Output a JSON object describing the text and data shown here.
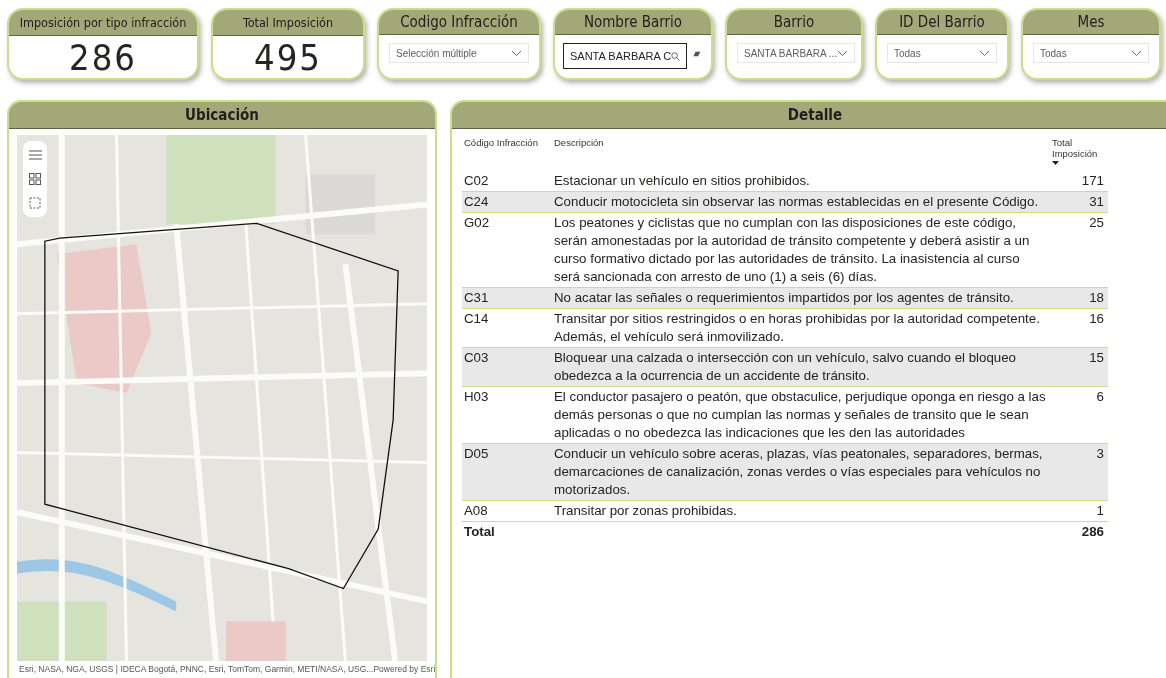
{
  "cards": [
    {
      "kind": "kpi",
      "title": "Imposición por tipo infracción",
      "value": "286"
    },
    {
      "kind": "kpi",
      "title": "Total Imposición",
      "value": "495"
    },
    {
      "kind": "dropdown",
      "title": "Codigo Infracción",
      "value": "Selección múltiple"
    },
    {
      "kind": "search",
      "title": "Nombre Barrio",
      "value": "SANTA BARBARA C"
    },
    {
      "kind": "dropdown",
      "title": "Barrio",
      "value": "SANTA BARBARA ..."
    },
    {
      "kind": "dropdown",
      "title": "ID Del Barrio",
      "value": "Todas"
    },
    {
      "kind": "dropdown",
      "title": "Mes",
      "value": "Todas"
    }
  ],
  "map": {
    "title": "Ubicación",
    "attribution": "Esri, NASA, NGA, USGS | IDECA Bogotá, PNNC, Esri, TomTom, Garmin, METI/NASA, USG...",
    "powered_by": "Powered by",
    "powered_link": "Esri"
  },
  "detail": {
    "title": "Detalle",
    "columns": [
      {
        "label": "Código Infracción",
        "sorted": false
      },
      {
        "label": "Descripción",
        "sorted": false
      },
      {
        "label": "Total Imposición",
        "sorted": true
      }
    ],
    "rows": [
      {
        "code": "C02",
        "description": "Estacionar un vehículo en sitios prohibidos.",
        "total": "171"
      },
      {
        "code": "C24",
        "description": "Conducir motocicleta sin observar las normas establecidas en el presente Código.",
        "total": "31"
      },
      {
        "code": "G02",
        "description": "Los peatones y ciclistas que no cumplan con las disposiciones de este código, serán amonestadas por la autoridad de tránsito competente y deberá asistir a un curso formativo dictado por las autoridades de tránsito. La inasistencia al curso será sancionada con arresto de uno (1) a seis (6) días.",
        "total": "25"
      },
      {
        "code": "C31",
        "description": "No acatar las señales o requerimientos impartidos por los agentes de tránsito.",
        "total": "18"
      },
      {
        "code": "C14",
        "description": "Transitar por sitios restringidos o en horas prohibidas por la autoridad competente. Además, el vehículo será inmovilizado.",
        "total": "16"
      },
      {
        "code": "C03",
        "description": "Bloquear una calzada o intersección con un vehículo, salvo cuando el bloqueo obedezca a la ocurrencia de un accidente de tránsito.",
        "total": "15"
      },
      {
        "code": "H03",
        "description": "El conductor pasajero o peatón, que obstaculice, perjudique oponga en riesgo a las demás personas o que no cumplan las normas y señales de transito que le sean aplicadas o no obedezca las indicaciones que les den las autoridades",
        "total": "6"
      },
      {
        "code": "D05",
        "description": "Conducir un vehículo sobre aceras, plazas, vías peatonales, separadores, bermas, demarcaciones de canalización, zonas verdes o vías especiales para vehículos no motorizados.",
        "total": "3"
      },
      {
        "code": "A08",
        "description": "Transitar por zonas prohibidas.",
        "total": "1"
      }
    ],
    "total_label": "Total",
    "total_value": "286"
  }
}
